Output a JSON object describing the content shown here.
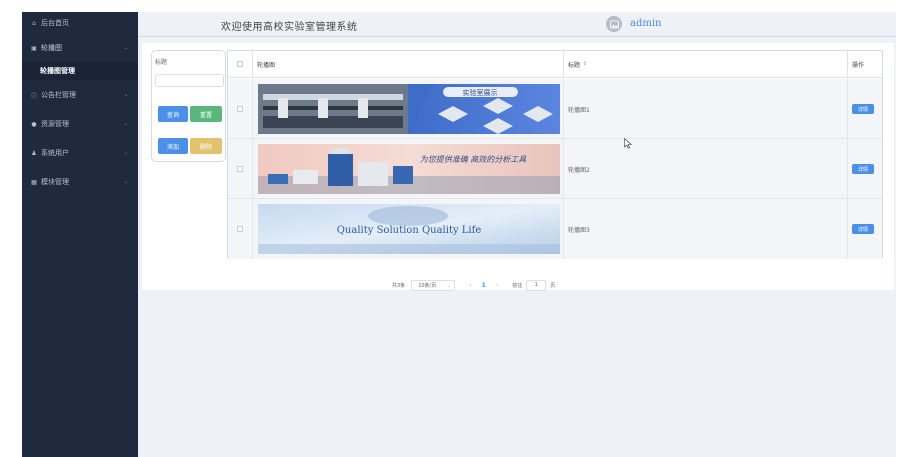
{
  "header": {
    "title": "欢迎使用高校实验室管理系统",
    "username": "admin"
  },
  "sidebar": {
    "home": "后台首页",
    "items": [
      {
        "label": "轮播图",
        "icon": "image-icon",
        "sub": [
          "轮播图管理"
        ]
      },
      {
        "label": "公告栏管理",
        "icon": "info-circle-icon"
      },
      {
        "label": "资源管理",
        "icon": "location-pin-icon"
      },
      {
        "label": "系统用户",
        "icon": "user-icon"
      },
      {
        "label": "模块管理",
        "icon": "grid-icon"
      }
    ]
  },
  "search": {
    "label": "标题",
    "value": "",
    "search_btn": "查询",
    "reset_btn": "重置",
    "add_btn": "添加",
    "delete_btn": "删除"
  },
  "table": {
    "columns": [
      "轮播图",
      "标题",
      "操作"
    ],
    "rows": [
      {
        "title": "轮播图1",
        "action": "详情",
        "banner_text": "实验室展示"
      },
      {
        "title": "轮播图2",
        "action": "详情",
        "banner_text": "为您提供准确 高效的分析工具"
      },
      {
        "title": "轮播图3",
        "action": "详情",
        "banner_text": "Quality Solution Quality Life"
      }
    ]
  },
  "pagination": {
    "total": "共3条",
    "page_size": "10条/页",
    "current_page": "1",
    "goto_label": "前往",
    "goto_value": "1",
    "page_unit": "页"
  },
  "colors": {
    "sidebar_bg": "#1f2a3e",
    "primary": "#4c8fe6",
    "success": "#5ab77c",
    "warning": "#e2c26f"
  }
}
